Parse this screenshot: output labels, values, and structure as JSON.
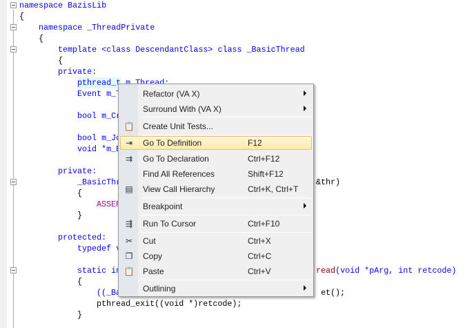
{
  "code": {
    "l1": "namespace BazisLib",
    "l2": "{",
    "l3": "namespace _ThreadPrivate",
    "l4": "{",
    "l5": "template <class DescendantClass> class _BasicThread",
    "l6": "{",
    "l7": "private:",
    "l8": "pthread_t m_Thread;",
    "l9": "Event m_T",
    "l11": "bool m_Cr",
    "l13": "bool m_Jo",
    "l14": "void *m_E",
    "l16": "private:",
    "l17a": "_BasicThr",
    "l17b": "&thr)",
    "l18": "{",
    "l19": "ASSER",
    "l20": "}",
    "l22": "protected:",
    "l23": "typedef v",
    "l25a": "static in",
    "l25b": "read",
    "l25c": "(void *pArg, int retcode)",
    "l26": "{",
    "l27a": "((_Ba",
    "l27b": "et();",
    "l28": "pthread_exit((void *)retcode);",
    "l29": "}"
  },
  "menu": {
    "items": [
      {
        "label": "Refactor (VA X)",
        "submenu": true
      },
      {
        "label": "Surround With (VA X)",
        "submenu": true
      },
      {
        "label": "Create Unit Tests...",
        "icon": "unit-test-icon"
      },
      {
        "label": "Go To Definition",
        "shortcut": "F12",
        "icon": "go-to-definition-icon",
        "highlighted": true
      },
      {
        "label": "Go To Declaration",
        "shortcut": "Ctrl+F12",
        "icon": "go-to-declaration-icon"
      },
      {
        "label": "Find All References",
        "shortcut": "Shift+F12"
      },
      {
        "label": "View Call Hierarchy",
        "shortcut": "Ctrl+K, Ctrl+T",
        "icon": "call-hierarchy-icon"
      },
      {
        "label": "Breakpoint",
        "submenu": true
      },
      {
        "label": "Run To Cursor",
        "shortcut": "Ctrl+F10",
        "icon": "run-to-cursor-icon"
      },
      {
        "label": "Cut",
        "shortcut": "Ctrl+X",
        "icon": "scissors-icon"
      },
      {
        "label": "Copy",
        "shortcut": "Ctrl+C",
        "icon": "copy-icon"
      },
      {
        "label": "Paste",
        "shortcut": "Ctrl+V",
        "icon": "paste-icon"
      },
      {
        "label": "Outlining",
        "submenu": true
      }
    ]
  }
}
